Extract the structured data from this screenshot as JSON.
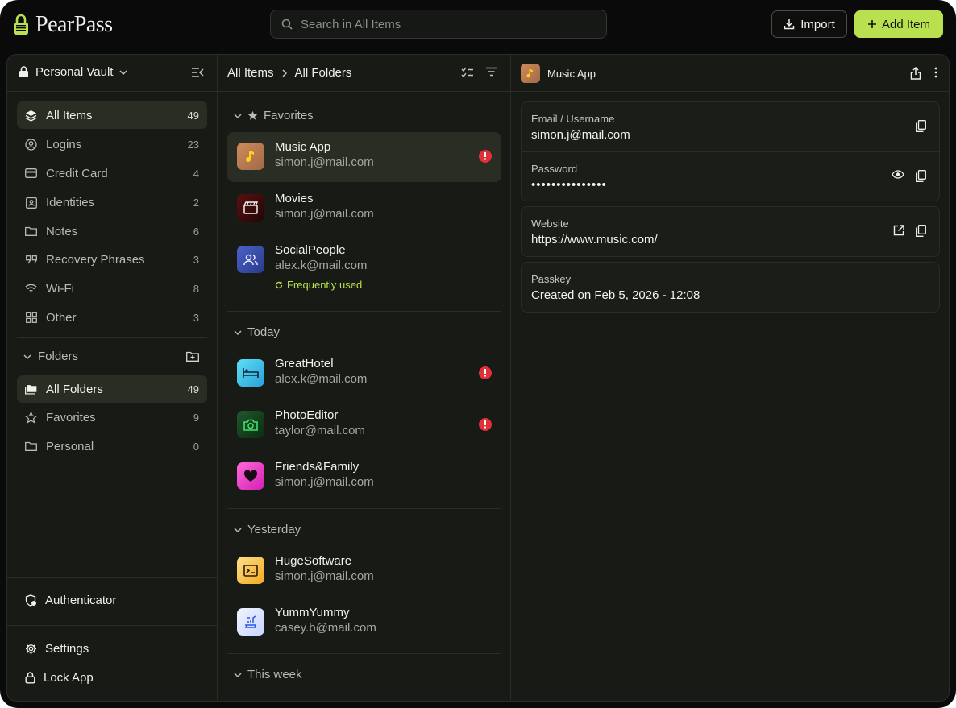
{
  "app": {
    "name": "PearPass"
  },
  "search": {
    "placeholder": "Search in All Items"
  },
  "toolbar": {
    "import_label": "Import",
    "add_label": "Add Item"
  },
  "sidebar": {
    "vault_name": "Personal Vault",
    "categories": [
      {
        "label": "All Items",
        "count": "49",
        "icon": "layers-icon",
        "active": true
      },
      {
        "label": "Logins",
        "count": "23",
        "icon": "user-circle-icon"
      },
      {
        "label": "Credit Card",
        "count": "4",
        "icon": "credit-card-icon"
      },
      {
        "label": "Identities",
        "count": "2",
        "icon": "id-badge-icon"
      },
      {
        "label": "Notes",
        "count": "6",
        "icon": "folder-icon"
      },
      {
        "label": "Recovery Phrases",
        "count": "3",
        "icon": "quote-icon"
      },
      {
        "label": "Wi-Fi",
        "count": "8",
        "icon": "wifi-icon"
      },
      {
        "label": "Other",
        "count": "3",
        "icon": "grid-icon"
      }
    ],
    "folders_label": "Folders",
    "folders": [
      {
        "label": "All Folders",
        "count": "49",
        "icon": "folders-icon",
        "active": true
      },
      {
        "label": "Favorites",
        "count": "9",
        "icon": "star-icon"
      },
      {
        "label": "Personal",
        "count": "0",
        "icon": "folder-icon"
      }
    ],
    "authenticator_label": "Authenticator",
    "settings_label": "Settings",
    "lock_label": "Lock App"
  },
  "list": {
    "breadcrumb": [
      "All Items",
      "All Folders"
    ],
    "sections": {
      "favorites": "Favorites",
      "today": "Today",
      "yesterday": "Yesterday",
      "this_week": "This week"
    },
    "items": [
      {
        "name": "Music App",
        "sub": "simon.j@mail.com",
        "icon": "music-note-icon",
        "warning": true,
        "active": true
      },
      {
        "name": "Movies",
        "sub": "simon.j@mail.com",
        "icon": "clapperboard-icon"
      },
      {
        "name": "SocialPeople",
        "sub": "alex.k@mail.com",
        "icon": "people-icon",
        "tag": "Frequently used"
      },
      {
        "name": "GreatHotel",
        "sub": "alex.k@mail.com",
        "icon": "bed-icon",
        "warning": true
      },
      {
        "name": "PhotoEditor",
        "sub": "taylor@mail.com",
        "icon": "camera-icon",
        "warning": true
      },
      {
        "name": "Friends&Family",
        "sub": "simon.j@mail.com",
        "icon": "heart-icon"
      },
      {
        "name": "HugeSoftware",
        "sub": "simon.j@mail.com",
        "icon": "terminal-icon"
      },
      {
        "name": "YummYummy",
        "sub": "casey.b@mail.com",
        "icon": "food-icon"
      }
    ]
  },
  "detail": {
    "title": "Music App",
    "fields": {
      "email_label": "Email / Username",
      "email_value": "simon.j@mail.com",
      "password_label": "Password",
      "password_value": "•••••••••••••••",
      "website_label": "Website",
      "website_value": "https://www.music.com/",
      "passkey_label": "Passkey",
      "passkey_value": "Created on Feb 5, 2026 - 12:08"
    }
  },
  "colors": {
    "accent": "#b8e04f",
    "warning": "#e0313a",
    "background": "#0a0a0a",
    "panel": "#181a15"
  }
}
